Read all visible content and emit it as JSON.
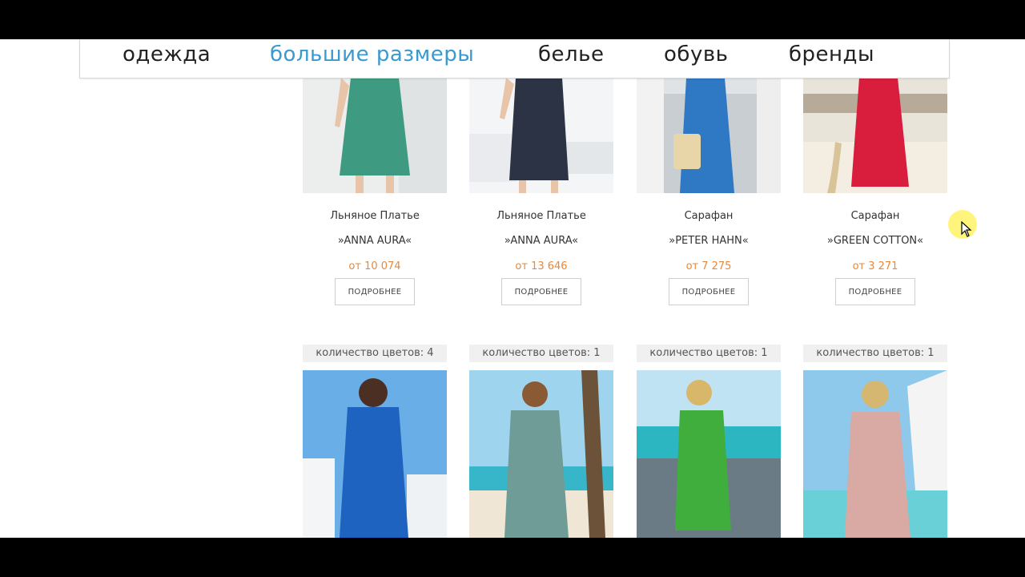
{
  "nav": {
    "items": [
      {
        "label": "одежда",
        "active": false
      },
      {
        "label": "большие размеры",
        "active": true
      },
      {
        "label": "белье",
        "active": false
      },
      {
        "label": "обувь",
        "active": false
      },
      {
        "label": "бренды",
        "active": false
      }
    ]
  },
  "products_row1": [
    {
      "title": "Льняное Платье",
      "brand": "»ANNA AURA«",
      "price": "от 10 074",
      "button": "ПОДРОБНЕЕ",
      "dress_color": "#3e9a80"
    },
    {
      "title": "Льняное Платье",
      "brand": "»ANNA AURA«",
      "price": "от 13 646",
      "button": "ПОДРОБНЕЕ",
      "dress_color": "#2b3345"
    },
    {
      "title": "Сарафан",
      "brand": "»PETER HAHN«",
      "price": "от 7 275",
      "button": "ПОДРОБНЕЕ",
      "dress_color": "#2e78c4"
    },
    {
      "title": "Сарафан",
      "brand": "»GREEN COTTON«",
      "price": "от 3 271",
      "button": "ПОДРОБНЕЕ",
      "dress_color": "#d81e3c"
    }
  ],
  "products_row2": [
    {
      "colors": "количество цветов: 4",
      "dress_color": "#1e63c0"
    },
    {
      "colors": "количество цветов: 1",
      "dress_color": "#6f9c96"
    },
    {
      "colors": "количество цветов: 1",
      "dress_color": "#3fae3c"
    },
    {
      "colors": "количество цветов: 1",
      "dress_color": "#d9a9a3"
    }
  ],
  "colors": {
    "accent_active_nav": "#3a9ad0",
    "price": "#e8883a",
    "badge_bg": "#f0f0f0"
  },
  "icons": {
    "cursor": "mouse-pointer-icon"
  }
}
